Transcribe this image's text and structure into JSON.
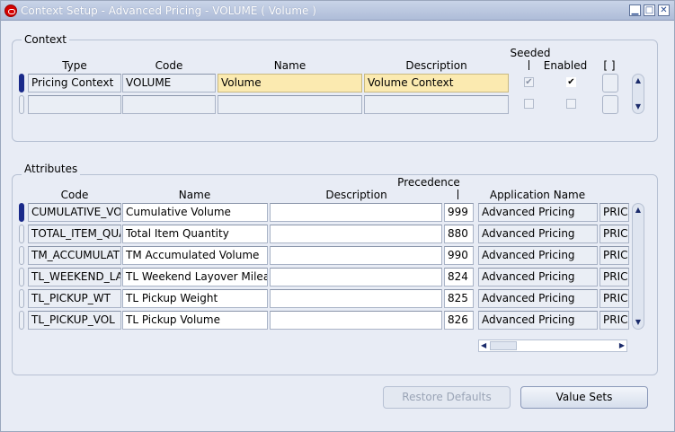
{
  "window": {
    "title": "Context Setup - Advanced Pricing - VOLUME ( Volume )"
  },
  "context": {
    "label": "Context",
    "headers": {
      "type": "Type",
      "code": "Code",
      "name": "Name",
      "description": "Description",
      "seeded": "Seeded",
      "enabled": "Enabled",
      "extra": "[ ]"
    },
    "rows": [
      {
        "type": "Pricing Context",
        "code": "VOLUME",
        "name": "Volume",
        "description": "Volume Context",
        "seeded": "✔",
        "enabled": "✔"
      },
      {
        "type": "",
        "code": "",
        "name": "",
        "description": "",
        "seeded": "",
        "enabled": ""
      }
    ]
  },
  "attributes": {
    "label": "Attributes",
    "headers": {
      "code": "Code",
      "name": "Name",
      "description": "Description",
      "precedence": "Precedence",
      "application_name": "Application Name"
    },
    "rows": [
      {
        "code": "CUMULATIVE_VOLUME",
        "name": "Cumulative Volume",
        "description": "",
        "precedence": "999",
        "application_name": "Advanced Pricing",
        "extra": "PRICING"
      },
      {
        "code": "TOTAL_ITEM_QUANTITY",
        "name": "Total Item Quantity",
        "description": "",
        "precedence": "880",
        "application_name": "Advanced Pricing",
        "extra": "PRICING"
      },
      {
        "code": "TM_ACCUMULATED_VOLUME",
        "name": "TM Accumulated Volume",
        "description": "",
        "precedence": "990",
        "application_name": "Advanced Pricing",
        "extra": "PRICING"
      },
      {
        "code": "TL_WEEKEND_LAYOVER",
        "name": "TL Weekend Layover Mileage",
        "description": "",
        "precedence": "824",
        "application_name": "Advanced Pricing",
        "extra": "PRICING"
      },
      {
        "code": "TL_PICKUP_WT",
        "name": "TL Pickup Weight",
        "description": "",
        "precedence": "825",
        "application_name": "Advanced Pricing",
        "extra": "PRICING"
      },
      {
        "code": "TL_PICKUP_VOL",
        "name": "TL Pickup Volume",
        "description": "",
        "precedence": "826",
        "application_name": "Advanced Pricing",
        "extra": "PRICING"
      }
    ]
  },
  "buttons": {
    "restore_defaults": "Restore Defaults",
    "value_sets": "Value Sets"
  },
  "icons": {
    "minimize": "minimize-icon",
    "maximize": "maximize-icon",
    "close": "close-icon"
  }
}
